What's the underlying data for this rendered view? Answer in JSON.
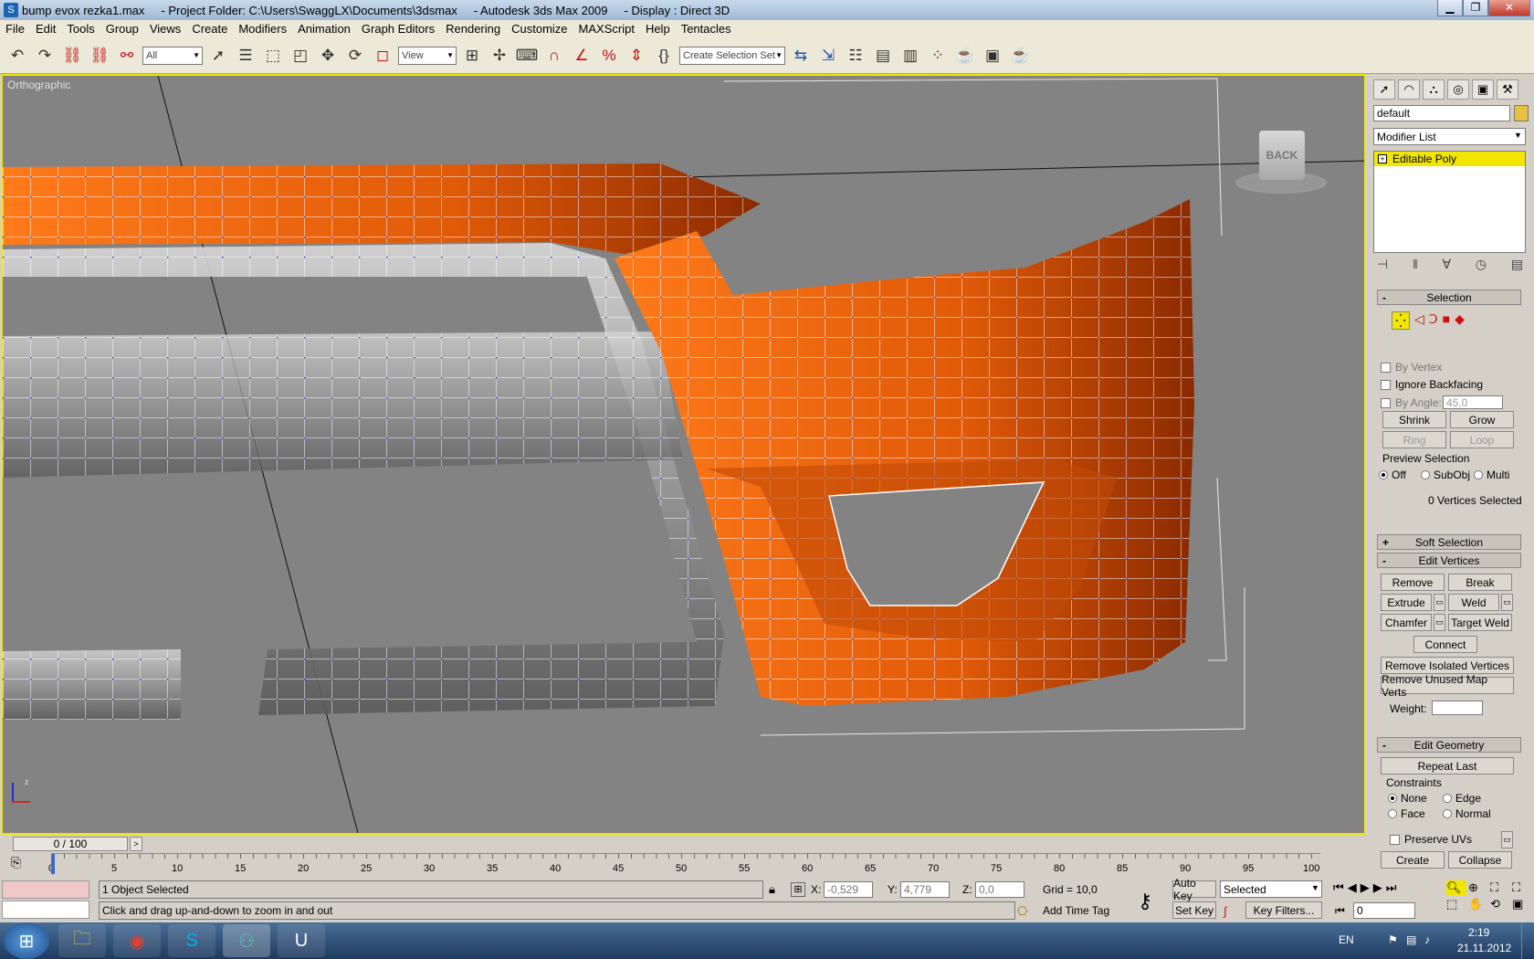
{
  "window": {
    "file": "bump evox rezka1.max",
    "project": "- Project Folder: C:\\Users\\SwaggLX\\Documents\\3dsmax",
    "app": "- Autodesk 3ds Max  2009",
    "display": "- Display : Direct 3D"
  },
  "menu": [
    "File",
    "Edit",
    "Tools",
    "Group",
    "Views",
    "Create",
    "Modifiers",
    "Animation",
    "Graph Editors",
    "Rendering",
    "Customize",
    "MAXScript",
    "Help",
    "Tentacles"
  ],
  "toolbar": {
    "filter": "All",
    "ref_coord": "View",
    "selection_set_placeholder": "Create Selection Set"
  },
  "viewport": {
    "label": "Orthographic",
    "viewcube_label": "BACK"
  },
  "command_panel": {
    "object_name": "default",
    "modifier_list": "Modifier List",
    "stack_item": "Editable Poly",
    "selection": {
      "title": "Selection",
      "by_vertex": "By Vertex",
      "ignore_backfacing": "Ignore Backfacing",
      "by_angle": "By Angle:",
      "angle_value": "45,0",
      "shrink": "Shrink",
      "grow": "Grow",
      "ring": "Ring",
      "loop": "Loop",
      "preview_title": "Preview Selection",
      "preview_off": "Off",
      "preview_subobj": "SubObj",
      "preview_multi": "Multi",
      "status": "0 Vertices Selected"
    },
    "soft_selection": "Soft Selection",
    "edit_vertices": {
      "title": "Edit Vertices",
      "remove": "Remove",
      "break": "Break",
      "extrude": "Extrude",
      "weld": "Weld",
      "chamfer": "Chamfer",
      "target_weld": "Target Weld",
      "connect": "Connect",
      "remove_isolated": "Remove Isolated Vertices",
      "remove_unused": "Remove Unused Map Verts",
      "weight": "Weight:"
    },
    "edit_geometry": {
      "title": "Edit Geometry",
      "repeat_last": "Repeat Last",
      "constraints": "Constraints",
      "none": "None",
      "edge": "Edge",
      "face": "Face",
      "normal": "Normal",
      "preserve_uvs": "Preserve UVs",
      "create": "Create",
      "collapse": "Collapse"
    }
  },
  "timeline": {
    "frame": "0 / 100",
    "ticks": [
      "0",
      "5",
      "10",
      "15",
      "20",
      "25",
      "30",
      "35",
      "40",
      "45",
      "50",
      "55",
      "60",
      "65",
      "70",
      "75",
      "80",
      "85",
      "90",
      "95",
      "100"
    ]
  },
  "status": {
    "selected": "1 Object Selected",
    "prompt": "Click and drag up-and-down to zoom in and out",
    "x_label": "X:",
    "x": "-0,529",
    "y_label": "Y:",
    "y": "4,779",
    "z_label": "Z:",
    "z": "0,0",
    "grid": "Grid = 10,0",
    "auto_key": "Auto Key",
    "set_key": "Set Key",
    "key_mode": "Selected",
    "key_filters": "Key Filters...",
    "add_time_tag": "Add Time Tag",
    "frame_field": "0"
  },
  "taskbar": {
    "lang": "EN",
    "time": "2:19",
    "date": "21.11.2012"
  },
  "colors": {
    "viewport_bg": "#838383",
    "mesh_orange": "#e8600a",
    "highlight": "#f2e600",
    "wire": "#ffffff",
    "vertex": "#3030d0"
  }
}
